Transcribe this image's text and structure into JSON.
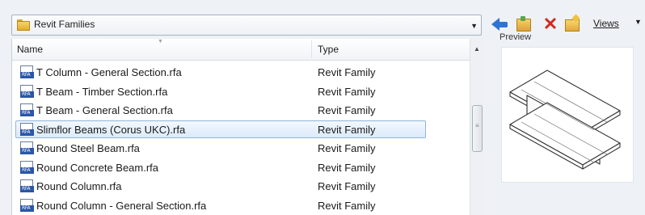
{
  "location": {
    "path": "Revit Families"
  },
  "toolbar": {
    "icons": [
      "back-arrow-icon",
      "folder-up-icon",
      "delete-icon",
      "new-folder-icon"
    ],
    "views_label": "Views"
  },
  "list": {
    "columns": {
      "name": "Name",
      "type": "Type"
    },
    "rows": [
      {
        "name": "T Column - General Section.rfa",
        "type": "Revit Family",
        "selected": false
      },
      {
        "name": "T Beam - Timber Section.rfa",
        "type": "Revit Family",
        "selected": false
      },
      {
        "name": "T Beam - General Section.rfa",
        "type": "Revit Family",
        "selected": false
      },
      {
        "name": "Slimflor Beams (Corus UKC).rfa",
        "type": "Revit Family",
        "selected": true
      },
      {
        "name": "Round Steel Beam.rfa",
        "type": "Revit Family",
        "selected": false
      },
      {
        "name": "Round Concrete Beam.rfa",
        "type": "Revit Family",
        "selected": false
      },
      {
        "name": "Round Column.rfa",
        "type": "Revit Family",
        "selected": false
      },
      {
        "name": "Round Column - General Section.rfa",
        "type": "Revit Family",
        "selected": false
      }
    ],
    "file_icon_text": "RFA"
  },
  "preview": {
    "label": "Preview",
    "image": "i-beam-3d-thumbnail"
  },
  "colors": {
    "selection_fill": "#dceafa",
    "selection_border": "#8fb4dc",
    "accent_blue": "#2f72d6",
    "delete_red": "#cf2a1f"
  }
}
